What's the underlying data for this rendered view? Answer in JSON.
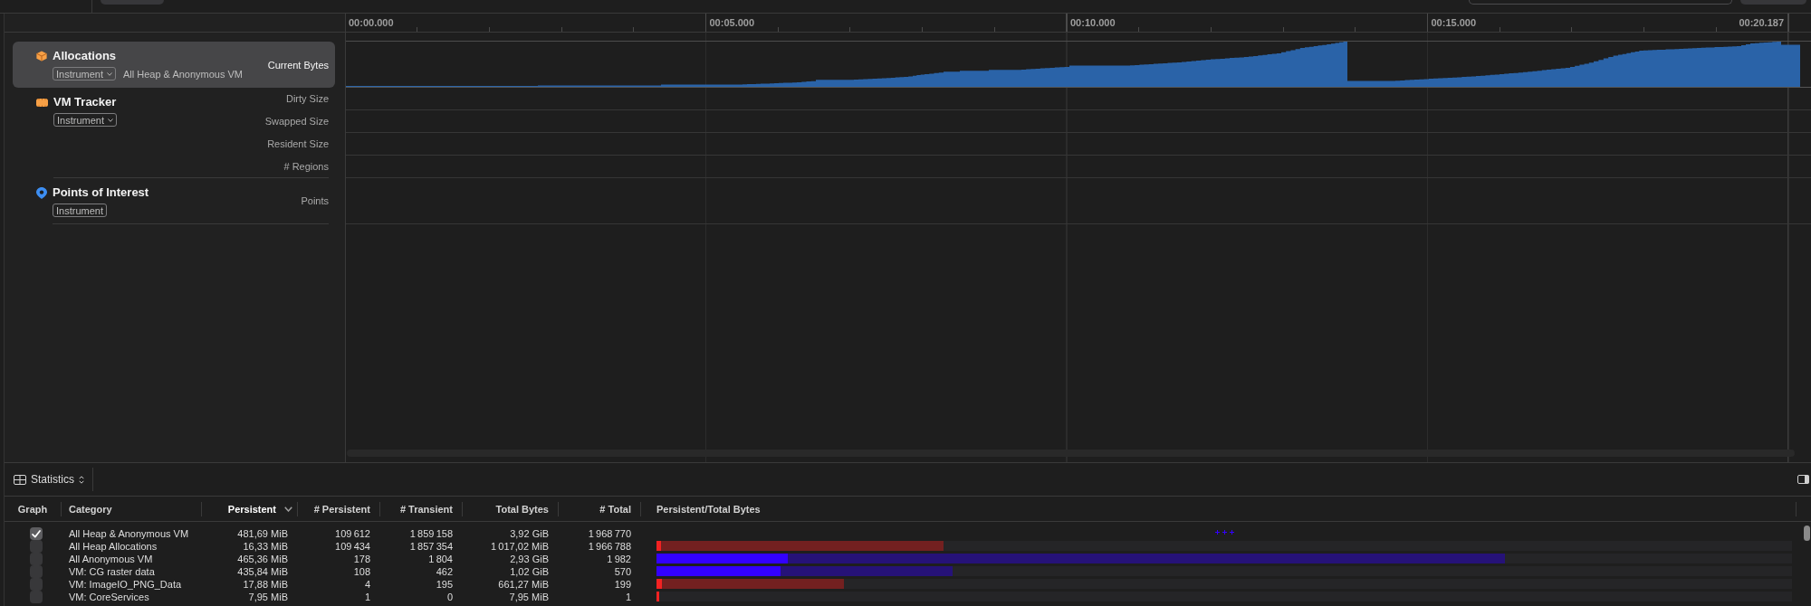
{
  "timeline": {
    "ruler": [
      "00:00.000",
      "00:05.000",
      "00:10.000",
      "00:15.000",
      "00:20.187"
    ]
  },
  "tracks": [
    {
      "name": "Allocations",
      "selected": true,
      "badge": {
        "label": "Instrument",
        "menu": true
      },
      "subtitle": "All Heap & Anonymous VM",
      "lanes": [
        {
          "label": "Current Bytes",
          "kind": "graph"
        }
      ]
    },
    {
      "name": "VM Tracker",
      "selected": false,
      "badge": {
        "label": "Instrument",
        "menu": true
      },
      "lanes": [
        {
          "label": "Dirty Size",
          "kind": "empty"
        },
        {
          "label": "Swapped Size",
          "kind": "empty"
        },
        {
          "label": "Resident Size",
          "kind": "empty"
        },
        {
          "label": "# Regions",
          "kind": "empty"
        }
      ]
    },
    {
      "name": "Points of Interest",
      "selected": false,
      "badge": {
        "label": "Instrument",
        "menu": false
      },
      "lanes": [
        {
          "label": "Points",
          "kind": "empty"
        }
      ]
    }
  ],
  "detail": {
    "view": "Statistics",
    "table": {
      "columns": [
        {
          "label": "Graph",
          "sorted": false
        },
        {
          "label": "Category",
          "sorted": false
        },
        {
          "label": "Persistent",
          "sorted": true
        },
        {
          "label": "# Persistent",
          "sorted": false
        },
        {
          "label": "# Transient",
          "sorted": false
        },
        {
          "label": "Total Bytes",
          "sorted": false
        },
        {
          "label": "# Total",
          "sorted": false
        },
        {
          "label": "Persistent/Total Bytes",
          "sorted": false
        }
      ],
      "rows": [
        {
          "cells": [
            {
              "kind": "checkbox",
              "checked": true
            },
            {
              "kind": "text",
              "text": "All Heap & Anonymous VM"
            },
            {
              "kind": "text",
              "text": "481,69 MiB"
            },
            {
              "kind": "text",
              "text": "109 612"
            },
            {
              "kind": "text",
              "text": "1 859 158"
            },
            {
              "kind": "text",
              "text": "3,92 GiB"
            },
            {
              "kind": "text",
              "text": "1 968 770"
            },
            {
              "kind": "marks",
              "color": "#3300ff"
            }
          ]
        },
        {
          "cells": [
            {
              "kind": "checkbox",
              "checked": false
            },
            {
              "kind": "text",
              "text": "All Heap Allocations"
            },
            {
              "kind": "text",
              "text": "16,33 MiB"
            },
            {
              "kind": "text",
              "text": "109 434"
            },
            {
              "kind": "text",
              "text": "1 857 354"
            },
            {
              "kind": "text",
              "text": "1 017,02 MiB"
            },
            {
              "kind": "text",
              "text": "1 966 788"
            },
            {
              "kind": "bar",
              "color": "#f22222",
              "total": {
                "level": 0.253
              },
              "persistent": {
                "level": 0.0041
              }
            }
          ]
        },
        {
          "cells": [
            {
              "kind": "checkbox",
              "checked": false
            },
            {
              "kind": "text",
              "text": "All Anonymous VM"
            },
            {
              "kind": "text",
              "text": "465,36 MiB"
            },
            {
              "kind": "text",
              "text": "178"
            },
            {
              "kind": "text",
              "text": "1 804"
            },
            {
              "kind": "text",
              "text": "2,93 GiB"
            },
            {
              "kind": "text",
              "text": "1 982"
            },
            {
              "kind": "bar",
              "color": "#3300ff",
              "total": {
                "level": 0.747
              },
              "persistent": {
                "level": 0.116
              }
            }
          ]
        },
        {
          "cells": [
            {
              "kind": "checkbox",
              "checked": false
            },
            {
              "kind": "text",
              "text": "VM: CG raster data"
            },
            {
              "kind": "text",
              "text": "435,84 MiB"
            },
            {
              "kind": "text",
              "text": "108"
            },
            {
              "kind": "text",
              "text": "462"
            },
            {
              "kind": "text",
              "text": "1,02 GiB"
            },
            {
              "kind": "text",
              "text": "570"
            },
            {
              "kind": "bar",
              "color": "#3300ff",
              "total": {
                "level": 0.261
              },
              "persistent": {
                "level": 0.109
              }
            }
          ]
        },
        {
          "cells": [
            {
              "kind": "checkbox",
              "checked": false
            },
            {
              "kind": "text",
              "text": "VM: ImageIO_PNG_Data"
            },
            {
              "kind": "text",
              "text": "17,88 MiB"
            },
            {
              "kind": "text",
              "text": "4"
            },
            {
              "kind": "text",
              "text": "195"
            },
            {
              "kind": "text",
              "text": "661,27 MiB"
            },
            {
              "kind": "text",
              "text": "199"
            },
            {
              "kind": "bar",
              "color": "#f22222",
              "total": {
                "level": 0.165
              },
              "persistent": {
                "level": 0.0045
              }
            }
          ]
        },
        {
          "cells": [
            {
              "kind": "checkbox",
              "checked": false
            },
            {
              "kind": "text",
              "text": "VM: CoreServices"
            },
            {
              "kind": "text",
              "text": "7,95 MiB"
            },
            {
              "kind": "text",
              "text": "1"
            },
            {
              "kind": "text",
              "text": "0"
            },
            {
              "kind": "text",
              "text": "7,95 MiB"
            },
            {
              "kind": "text",
              "text": "1"
            },
            {
              "kind": "bar",
              "color": "#f22222",
              "persistent": {
                "level": 0.0024
              }
            }
          ]
        }
      ]
    }
  }
}
